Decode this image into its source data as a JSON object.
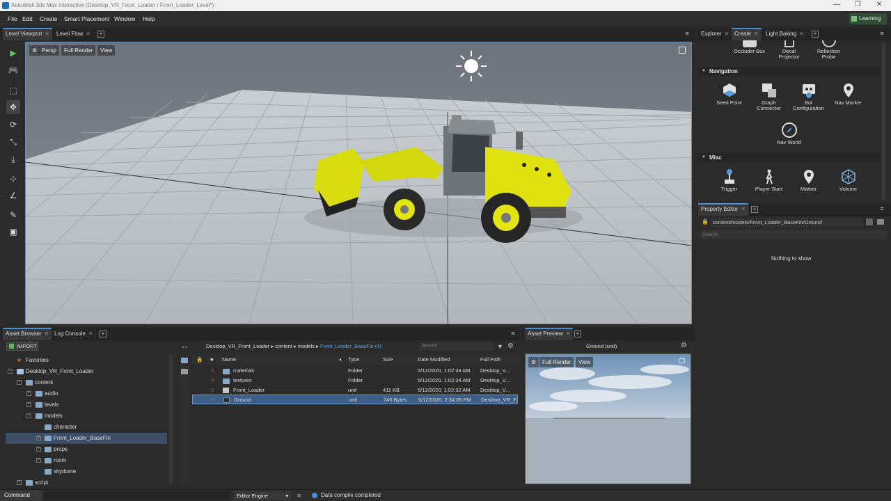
{
  "window": {
    "title": "Autodesk 3ds Max Interactive (Desktop_VR_Front_Loader / Front_Loader_Level*)",
    "controls": [
      "—",
      "❐",
      "✕"
    ]
  },
  "menu": {
    "items": [
      "File",
      "Edit",
      "Create",
      "Smart Placement",
      "Window",
      "Help"
    ],
    "learning_label": "Learning"
  },
  "viewport_tabs": [
    {
      "label": "Level Viewport",
      "active": true
    },
    {
      "label": "Level Flow",
      "active": false
    }
  ],
  "viewport": {
    "settings_icon": "gear-icon",
    "perspective": "Persp",
    "render_mode": "Full Render",
    "view": "View"
  },
  "toolbar_icons": [
    "play-icon",
    "gamepad-icon",
    "select-icon",
    "move-icon",
    "rotate-icon",
    "scale-icon",
    "place-icon",
    "snap-icon",
    "measure-icon",
    "paint-icon",
    "object-icon"
  ],
  "right_tabs": [
    {
      "label": "Explorer",
      "active": false
    },
    {
      "label": "Create",
      "active": true
    },
    {
      "label": "Light Baking",
      "active": false
    }
  ],
  "create": {
    "top_items": [
      {
        "label": "Occluder Box"
      },
      {
        "label": "Decal\nProjector"
      },
      {
        "label": "Reflection\nProbe"
      }
    ],
    "categories": [
      {
        "name": "Navigation",
        "items": [
          {
            "label": "Seed Point",
            "icon": "seed-point-icon"
          },
          {
            "label": "Graph\nConnector",
            "icon": "graph-connector-icon"
          },
          {
            "label": "Bot\nConfiguration",
            "icon": "bot-configuration-icon"
          },
          {
            "label": "Nav Marker",
            "icon": "nav-marker-icon"
          },
          {
            "label": "Nav World",
            "icon": "nav-world-icon"
          }
        ]
      },
      {
        "name": "Misc",
        "items": [
          {
            "label": "Trigger",
            "icon": "trigger-icon"
          },
          {
            "label": "Player Start",
            "icon": "player-start-icon"
          },
          {
            "label": "Marker",
            "icon": "marker-icon"
          },
          {
            "label": "Volume",
            "icon": "volume-icon"
          }
        ]
      }
    ]
  },
  "property_editor": {
    "tab": "Property Editor",
    "path": "content/models/Front_Loader_BaseFin/Ground",
    "search_placeholder": "Search",
    "empty_message": "Nothing to show"
  },
  "bottom_tabs": [
    {
      "label": "Asset Browser",
      "active": true
    },
    {
      "label": "Log Console",
      "active": false
    }
  ],
  "asset_browser": {
    "import_label": "IMPORT",
    "breadcrumb": [
      "Desktop_VR_Front_Loader",
      "content",
      "models",
      "Front_Loader_BaseFin (4)"
    ],
    "search_placeholder": "Search",
    "tree": [
      {
        "label": "Favorites",
        "depth": 0,
        "icon": "star"
      },
      {
        "label": "Desktop_VR_Front_Loader",
        "depth": 0,
        "icon": "project"
      },
      {
        "label": "content",
        "depth": 1,
        "icon": "folder"
      },
      {
        "label": "audio",
        "depth": 2,
        "icon": "folder"
      },
      {
        "label": "levels",
        "depth": 2,
        "icon": "folder"
      },
      {
        "label": "models",
        "depth": 2,
        "icon": "folder"
      },
      {
        "label": "character",
        "depth": 3,
        "icon": "folder"
      },
      {
        "label": "Front_Loader_BaseFin",
        "depth": 3,
        "icon": "folder",
        "selected": true
      },
      {
        "label": "props",
        "depth": 3,
        "icon": "folder"
      },
      {
        "label": "room",
        "depth": 3,
        "icon": "folder"
      },
      {
        "label": "skydome",
        "depth": 3,
        "icon": "folder"
      },
      {
        "label": "script",
        "depth": 1,
        "icon": "folder"
      }
    ],
    "columns": [
      "Name",
      "Type",
      "Size",
      "Date Modified",
      "Full Path"
    ],
    "rows": [
      {
        "name": "materials",
        "type": "Folder",
        "size": "",
        "date": "5/12/2020, 1:02:34 AM",
        "path": "Desktop_V...",
        "icon": "folder"
      },
      {
        "name": "textures",
        "type": "Folder",
        "size": "",
        "date": "5/12/2020, 1:02:34 AM",
        "path": "Desktop_V...",
        "icon": "folder"
      },
      {
        "name": "Front_Loader",
        "type": "unit",
        "size": "411 KB",
        "date": "5/12/2020, 1:02:32 AM",
        "path": "Desktop_V...",
        "icon": "unit"
      },
      {
        "name": "Ground",
        "type": "unit",
        "size": "740 Bytes",
        "date": "5/12/2020, 2:34:05 PM",
        "path": "Desktop_VR_F...",
        "icon": "unit",
        "selected": true
      }
    ]
  },
  "asset_preview": {
    "tab": "Asset Preview",
    "title": "Ground (unit)",
    "render_mode": "Full Render",
    "view": "View"
  },
  "status": {
    "command_label": "Command",
    "engine": "Editor Engine",
    "message": "Data compile completed"
  }
}
